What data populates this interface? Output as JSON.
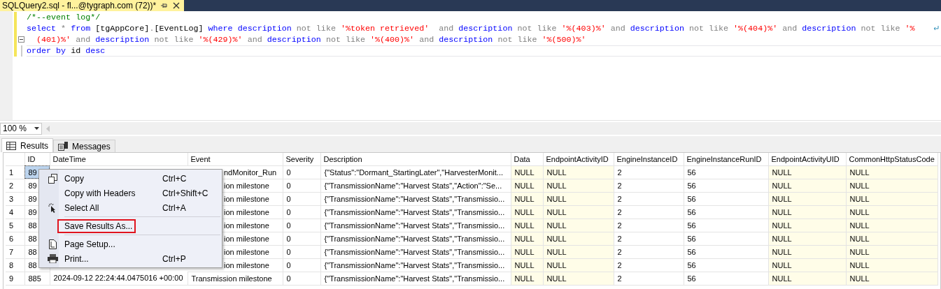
{
  "document_tab": {
    "title": "SQLQuery2.sql - fl...@tygraph.com (72))*",
    "selected": true
  },
  "editor": {
    "lines": [
      {
        "modified": true,
        "current": false,
        "tokens": [
          {
            "kind": "comment",
            "text": "/*--event log*/"
          }
        ]
      },
      {
        "modified": true,
        "current": false,
        "tokens": [
          {
            "kind": "keyword",
            "text": "select"
          },
          {
            "kind": "operator",
            "text": " * "
          },
          {
            "kind": "keyword",
            "text": "from"
          },
          {
            "kind": "plain",
            "text": " [tgAppCore]"
          },
          {
            "kind": "operator",
            "text": "."
          },
          {
            "kind": "plain",
            "text": "[EventLog] "
          },
          {
            "kind": "keyword",
            "text": "where description "
          },
          {
            "kind": "operator",
            "text": "not like "
          },
          {
            "kind": "string",
            "text": "'%token retrieved'"
          },
          {
            "kind": "operator",
            "text": "  and "
          },
          {
            "kind": "keyword",
            "text": "description "
          },
          {
            "kind": "operator",
            "text": "not like "
          },
          {
            "kind": "string",
            "text": "'%(403)%'"
          },
          {
            "kind": "operator",
            "text": " and "
          },
          {
            "kind": "keyword",
            "text": "description "
          },
          {
            "kind": "operator",
            "text": "not like "
          },
          {
            "kind": "string",
            "text": "'%(404)%'"
          },
          {
            "kind": "operator",
            "text": " and "
          },
          {
            "kind": "keyword",
            "text": "description "
          },
          {
            "kind": "operator",
            "text": "not like "
          },
          {
            "kind": "string",
            "text": "'%"
          }
        ]
      },
      {
        "modified": true,
        "current": false,
        "tokens": [
          {
            "kind": "string",
            "text": "  (401)%'"
          },
          {
            "kind": "operator",
            "text": " and "
          },
          {
            "kind": "keyword",
            "text": "description "
          },
          {
            "kind": "operator",
            "text": "not like "
          },
          {
            "kind": "string",
            "text": "'%(429)%'"
          },
          {
            "kind": "operator",
            "text": " and "
          },
          {
            "kind": "keyword",
            "text": "description "
          },
          {
            "kind": "operator",
            "text": "not like "
          },
          {
            "kind": "string",
            "text": "'%(400)%'"
          },
          {
            "kind": "operator",
            "text": " and "
          },
          {
            "kind": "keyword",
            "text": "description "
          },
          {
            "kind": "operator",
            "text": "not like "
          },
          {
            "kind": "string",
            "text": "'%(500)%'"
          }
        ]
      },
      {
        "modified": true,
        "current": true,
        "tokens": [
          {
            "kind": "keyword",
            "text": "order by "
          },
          {
            "kind": "plain",
            "text": "id "
          },
          {
            "kind": "keyword",
            "text": "desc"
          }
        ]
      }
    ]
  },
  "zoom": {
    "value": "100 %"
  },
  "result_tabs": [
    {
      "label": "Results",
      "selected": true
    },
    {
      "label": "Messages",
      "selected": false
    }
  ],
  "grid": {
    "columns": [
      {
        "label": "ID",
        "shaded": false
      },
      {
        "label": "DateTime",
        "shaded": false
      },
      {
        "label": "Event",
        "shaded": false
      },
      {
        "label": "Severity",
        "shaded": false
      },
      {
        "label": "Description",
        "shaded": false
      },
      {
        "label": "Data",
        "shaded": true
      },
      {
        "label": "EndpointActivityID",
        "shaded": true
      },
      {
        "label": "EngineInstanceID",
        "shaded": false
      },
      {
        "label": "EngineInstanceRunID",
        "shaded": false
      },
      {
        "label": "EndpointActivityUID",
        "shaded": true
      },
      {
        "label": "CommonHttpStatusCode",
        "shaded": true
      }
    ],
    "rows": [
      {
        "number": "1",
        "id_cell_selected": true,
        "cells": [
          "89",
          null,
          "ndMonitor_Run",
          "0",
          "{\"Status\":\"Dormant_StartingLater\",\"HarvesterMonit...",
          "NULL",
          "NULL",
          "2",
          "56",
          "NULL",
          "NULL"
        ]
      },
      {
        "number": "2",
        "id_cell_selected": false,
        "cells": [
          "89",
          null,
          "ion milestone",
          "0",
          "{\"TransmissionName\":\"Harvest Stats\",\"Action\":\"Se...",
          "NULL",
          "NULL",
          "2",
          "56",
          "NULL",
          "NULL"
        ]
      },
      {
        "number": "3",
        "id_cell_selected": false,
        "cells": [
          "89",
          null,
          "ion milestone",
          "0",
          "{\"TransmissionName\":\"Harvest Stats\",\"Transmissio...",
          "NULL",
          "NULL",
          "2",
          "56",
          "NULL",
          "NULL"
        ]
      },
      {
        "number": "4",
        "id_cell_selected": false,
        "cells": [
          "89",
          null,
          "ion milestone",
          "0",
          "{\"TransmissionName\":\"Harvest Stats\",\"Transmissio...",
          "NULL",
          "NULL",
          "2",
          "56",
          "NULL",
          "NULL"
        ]
      },
      {
        "number": "5",
        "id_cell_selected": false,
        "cells": [
          "88",
          null,
          "ion milestone",
          "0",
          "{\"TransmissionName\":\"Harvest Stats\",\"Transmissio...",
          "NULL",
          "NULL",
          "2",
          "56",
          "NULL",
          "NULL"
        ]
      },
      {
        "number": "6",
        "id_cell_selected": false,
        "cells": [
          "88",
          null,
          "ion milestone",
          "0",
          "{\"TransmissionName\":\"Harvest Stats\",\"Transmissio...",
          "NULL",
          "NULL",
          "2",
          "56",
          "NULL",
          "NULL"
        ]
      },
      {
        "number": "7",
        "id_cell_selected": false,
        "cells": [
          "88",
          null,
          "ion milestone",
          "0",
          "{\"TransmissionName\":\"Harvest Stats\",\"Transmissio...",
          "NULL",
          "NULL",
          "2",
          "56",
          "NULL",
          "NULL"
        ]
      },
      {
        "number": "8",
        "id_cell_selected": false,
        "cells": [
          "88",
          null,
          "ion milestone",
          "0",
          "{\"TransmissionName\":\"Harvest Stats\",\"Transmissio...",
          "NULL",
          "NULL",
          "2",
          "56",
          "NULL",
          "NULL"
        ]
      },
      {
        "number": "9",
        "id_cell_selected": false,
        "cells": [
          "885",
          "2024-09-12 22:24:44.0475016 +00:00",
          "Transmission milestone",
          "0",
          "{\"TransmissionName\":\"Harvest Stats\",\"Transmissio...",
          "NULL",
          "NULL",
          "2",
          "56",
          "NULL",
          "NULL"
        ]
      }
    ]
  },
  "context_menu": {
    "items": [
      {
        "kind": "command",
        "label": "Copy",
        "shortcut": "Ctrl+C",
        "highlighted": false
      },
      {
        "kind": "command",
        "label": "Copy with Headers",
        "shortcut": "Ctrl+Shift+C",
        "highlighted": false
      },
      {
        "kind": "command",
        "label": "Select All",
        "shortcut": "Ctrl+A",
        "highlighted": false
      },
      {
        "kind": "separator"
      },
      {
        "kind": "command",
        "label": "Save Results As...",
        "highlighted": true
      },
      {
        "kind": "separator"
      },
      {
        "kind": "command",
        "label": "Page Setup...",
        "highlighted": false
      },
      {
        "kind": "command",
        "label": "Print...",
        "shortcut": "Ctrl+P",
        "highlighted": false
      }
    ]
  }
}
